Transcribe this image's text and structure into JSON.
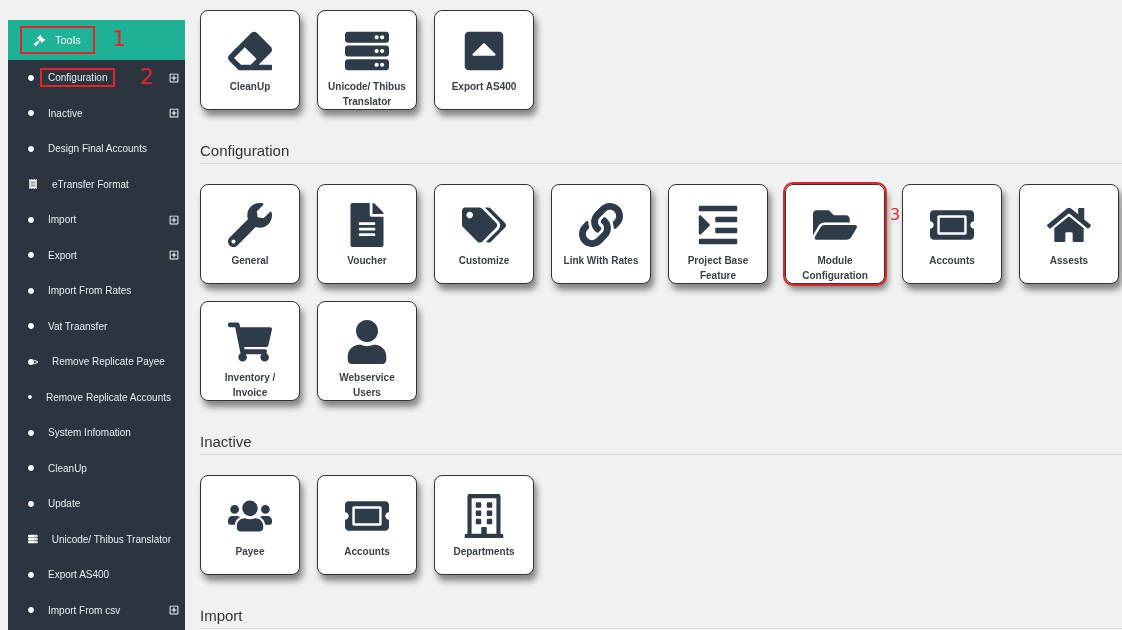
{
  "sidebar": {
    "header": {
      "label": "Tools",
      "annotation": "1"
    },
    "items": [
      {
        "label": "Configuration",
        "kind": "dot",
        "expandable": true,
        "annotation": "2"
      },
      {
        "label": "Inactive",
        "kind": "dot",
        "expandable": true
      },
      {
        "label": "Design Final Accounts",
        "kind": "dot",
        "expandable": false
      },
      {
        "label": "eTransfer Format",
        "kind": "receipt",
        "expandable": false
      },
      {
        "label": "Import",
        "kind": "dot",
        "expandable": true
      },
      {
        "label": "Export",
        "kind": "dot",
        "expandable": true
      },
      {
        "label": "Import From Rates",
        "kind": "dot",
        "expandable": false
      },
      {
        "label": "Vat Traansfer",
        "kind": "dot",
        "expandable": false
      },
      {
        "label": "Remove Replicate Payee",
        "kind": "pointer",
        "expandable": false
      },
      {
        "label": "Remove Replicate Accounts",
        "kind": "dot",
        "expandable": false
      },
      {
        "label": "System Infomation",
        "kind": "dot",
        "expandable": false
      },
      {
        "label": "CleanUp",
        "kind": "dot",
        "expandable": false
      },
      {
        "label": "Update",
        "kind": "dot",
        "expandable": false
      },
      {
        "label": "Unicode/ Thibus Translator",
        "kind": "bars",
        "expandable": false
      },
      {
        "label": "Export AS400",
        "kind": "dot",
        "expandable": false
      },
      {
        "label": "Import From csv",
        "kind": "dot",
        "expandable": true
      }
    ]
  },
  "sections": [
    {
      "tiles": [
        {
          "label": "CleanUp",
          "kind": "eraser"
        },
        {
          "label": "Unicode/ Thibus Translator",
          "kind": "bars"
        },
        {
          "label": "Export AS400",
          "kind": "upload"
        }
      ]
    },
    {
      "title": "Configuration",
      "tiles": [
        {
          "label": "General",
          "kind": "wrench"
        },
        {
          "label": "Voucher",
          "kind": "file"
        },
        {
          "label": "Customize",
          "kind": "tags"
        },
        {
          "label": "Link With Rates",
          "kind": "link"
        },
        {
          "label": "Project Base Feature",
          "kind": "indent"
        },
        {
          "label": "Module Configuration",
          "kind": "folder",
          "annotation": "3"
        },
        {
          "label": "Accounts",
          "kind": "ticket"
        },
        {
          "label": "Assests",
          "kind": "home"
        },
        {
          "label": "Inventory / Invoice",
          "kind": "cart"
        },
        {
          "label": "Webservice Users",
          "kind": "user"
        }
      ]
    },
    {
      "title": "Inactive",
      "tiles": [
        {
          "label": "Payee",
          "kind": "users"
        },
        {
          "label": "Accounts",
          "kind": "ticket"
        },
        {
          "label": "Departments",
          "kind": "building"
        }
      ]
    },
    {
      "title": "Import"
    }
  ]
}
